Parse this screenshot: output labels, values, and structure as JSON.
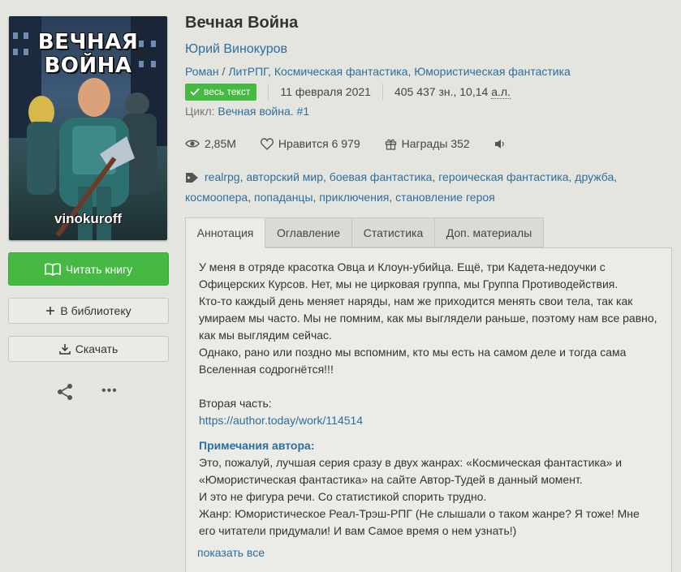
{
  "cover": {
    "title_line1": "ВЕЧНАЯ",
    "title_line2": "ВОЙНА",
    "author": "vinokuroff"
  },
  "actions": {
    "read_label": "Читать книгу",
    "library_label": "В библиотеку",
    "download_label": "Скачать",
    "share_icon": "share-icon",
    "more_label": "•••"
  },
  "book": {
    "title": "Вечная Война",
    "author": "Юрий Винокуров",
    "genre_root": "Роман",
    "genre_sep": " / ",
    "genres": [
      "ЛитРПГ",
      "Космическая фантастика",
      "Юмористическая фантастика"
    ],
    "status_badge": "весь текст",
    "date": "11 февраля 2021",
    "size_chars": "405 437 зн., 10,14",
    "size_unit": "а.л.",
    "cycle_label": "Цикл:",
    "cycle_name": "Вечная война. #1"
  },
  "stats": {
    "views": "2,85M",
    "likes_label": "Нравится",
    "likes": "6 979",
    "awards_label": "Награды",
    "awards": "352"
  },
  "tags": [
    "realrpg",
    "авторский мир",
    "боевая фантастика",
    "героическая фантастика",
    "дружба",
    "космоопера",
    "попаданцы",
    "приключения",
    "становление героя"
  ],
  "tabs": [
    "Аннотация",
    "Оглавление",
    "Статистика",
    "Доп. материалы"
  ],
  "annotation": {
    "p1": "У меня в отряде красотка Овца и Клоун-убийца. Ещё, три Кадета-недоучки с Офицерских Курсов. Нет, мы не цирковая группа, мы Группа Противодействия.",
    "p2": "Кто-то каждый день меняет наряды, нам же приходится менять свои тела, так как умираем мы часто. Мы не помним, как мы выглядели раньше, поэтому нам все равно, как мы выглядим сейчас.",
    "p3": "Однако, рано или поздно мы вспомним, кто мы есть на самом деле и тогда сама Вселенная содрогнётся!!!",
    "second_part_label": "Вторая часть:",
    "second_part_link": "https://author.today/work/114514",
    "notes_heading": "Примечания автора:",
    "n1": "Это, пожалуй, лучшая серия сразу в двух жанрах: «Космическая фантастика» и «Юмористическая фантастика» на сайте Автор-Тудей в данный момент.",
    "n2": "И это не фигура речи. Со статистикой спорить трудно.",
    "n3": "Жанр: Юмористическое Реал-Трэш-РПГ (Не слышали о таком жанре? Я тоже! Мне его читатели придумали! И вам Самое время о нем узнать!)",
    "show_all": "показать все"
  }
}
